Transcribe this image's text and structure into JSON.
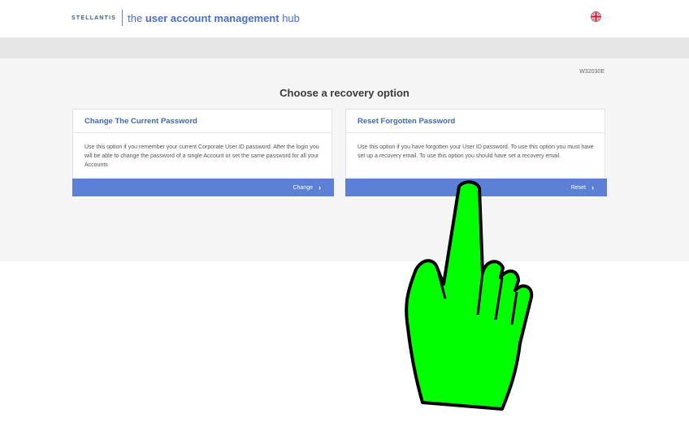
{
  "header": {
    "brand_logo": "STELLANTIS",
    "title_prefix": "the ",
    "title_bold": "user account management",
    "title_suffix": " hub",
    "language_icon": "uk-flag-icon"
  },
  "main": {
    "code": "W32030E",
    "heading": "Choose a recovery option",
    "cards": [
      {
        "title": "Change The Current Password",
        "description": "Use this option if you remember your current Corporate User ID password. After the login you will be able to change the password of a single Account or set the same password for all your Accounts",
        "button_label": "Change",
        "button_icon": "chevron-right-icon"
      },
      {
        "title": "Reset Forgotten Password",
        "description": "Use this option if you have forgotten your User ID password. To use this option you must have set up a recovery email. To use this option you should have set a recovery email.",
        "button_label": "Reset",
        "button_icon": "chevron-right-icon"
      }
    ]
  },
  "overlay": {
    "pointer_icon": "pointing-hand-icon",
    "pointer_color": "#00ff00"
  },
  "colors": {
    "accent": "#5b80d6",
    "title_blue": "#3f67c8",
    "background": "#f4f5f4"
  }
}
